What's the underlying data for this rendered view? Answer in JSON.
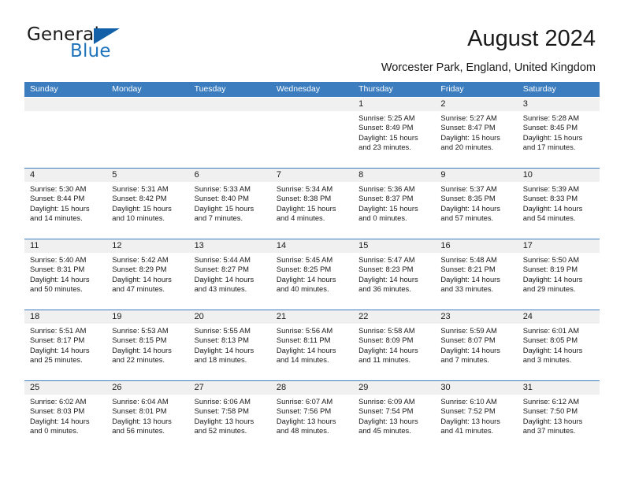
{
  "brand": {
    "name_part1": "General",
    "name_part2": "Blue",
    "accent_color": "#1261a8",
    "text_color": "#1f74bb"
  },
  "header": {
    "title": "August 2024",
    "subtitle": "Worcester Park, England, United Kingdom"
  },
  "calendar": {
    "header_bg": "#3b7dbf",
    "daynum_bg": "#f0f0f0",
    "weekday_headers": [
      "Sunday",
      "Monday",
      "Tuesday",
      "Wednesday",
      "Thursday",
      "Friday",
      "Saturday"
    ],
    "weeks": [
      [
        {
          "day": "",
          "details": ""
        },
        {
          "day": "",
          "details": ""
        },
        {
          "day": "",
          "details": ""
        },
        {
          "day": "",
          "details": ""
        },
        {
          "day": "1",
          "details": "Sunrise: 5:25 AM\nSunset: 8:49 PM\nDaylight: 15 hours\nand 23 minutes."
        },
        {
          "day": "2",
          "details": "Sunrise: 5:27 AM\nSunset: 8:47 PM\nDaylight: 15 hours\nand 20 minutes."
        },
        {
          "day": "3",
          "details": "Sunrise: 5:28 AM\nSunset: 8:45 PM\nDaylight: 15 hours\nand 17 minutes."
        }
      ],
      [
        {
          "day": "4",
          "details": "Sunrise: 5:30 AM\nSunset: 8:44 PM\nDaylight: 15 hours\nand 14 minutes."
        },
        {
          "day": "5",
          "details": "Sunrise: 5:31 AM\nSunset: 8:42 PM\nDaylight: 15 hours\nand 10 minutes."
        },
        {
          "day": "6",
          "details": "Sunrise: 5:33 AM\nSunset: 8:40 PM\nDaylight: 15 hours\nand 7 minutes."
        },
        {
          "day": "7",
          "details": "Sunrise: 5:34 AM\nSunset: 8:38 PM\nDaylight: 15 hours\nand 4 minutes."
        },
        {
          "day": "8",
          "details": "Sunrise: 5:36 AM\nSunset: 8:37 PM\nDaylight: 15 hours\nand 0 minutes."
        },
        {
          "day": "9",
          "details": "Sunrise: 5:37 AM\nSunset: 8:35 PM\nDaylight: 14 hours\nand 57 minutes."
        },
        {
          "day": "10",
          "details": "Sunrise: 5:39 AM\nSunset: 8:33 PM\nDaylight: 14 hours\nand 54 minutes."
        }
      ],
      [
        {
          "day": "11",
          "details": "Sunrise: 5:40 AM\nSunset: 8:31 PM\nDaylight: 14 hours\nand 50 minutes."
        },
        {
          "day": "12",
          "details": "Sunrise: 5:42 AM\nSunset: 8:29 PM\nDaylight: 14 hours\nand 47 minutes."
        },
        {
          "day": "13",
          "details": "Sunrise: 5:44 AM\nSunset: 8:27 PM\nDaylight: 14 hours\nand 43 minutes."
        },
        {
          "day": "14",
          "details": "Sunrise: 5:45 AM\nSunset: 8:25 PM\nDaylight: 14 hours\nand 40 minutes."
        },
        {
          "day": "15",
          "details": "Sunrise: 5:47 AM\nSunset: 8:23 PM\nDaylight: 14 hours\nand 36 minutes."
        },
        {
          "day": "16",
          "details": "Sunrise: 5:48 AM\nSunset: 8:21 PM\nDaylight: 14 hours\nand 33 minutes."
        },
        {
          "day": "17",
          "details": "Sunrise: 5:50 AM\nSunset: 8:19 PM\nDaylight: 14 hours\nand 29 minutes."
        }
      ],
      [
        {
          "day": "18",
          "details": "Sunrise: 5:51 AM\nSunset: 8:17 PM\nDaylight: 14 hours\nand 25 minutes."
        },
        {
          "day": "19",
          "details": "Sunrise: 5:53 AM\nSunset: 8:15 PM\nDaylight: 14 hours\nand 22 minutes."
        },
        {
          "day": "20",
          "details": "Sunrise: 5:55 AM\nSunset: 8:13 PM\nDaylight: 14 hours\nand 18 minutes."
        },
        {
          "day": "21",
          "details": "Sunrise: 5:56 AM\nSunset: 8:11 PM\nDaylight: 14 hours\nand 14 minutes."
        },
        {
          "day": "22",
          "details": "Sunrise: 5:58 AM\nSunset: 8:09 PM\nDaylight: 14 hours\nand 11 minutes."
        },
        {
          "day": "23",
          "details": "Sunrise: 5:59 AM\nSunset: 8:07 PM\nDaylight: 14 hours\nand 7 minutes."
        },
        {
          "day": "24",
          "details": "Sunrise: 6:01 AM\nSunset: 8:05 PM\nDaylight: 14 hours\nand 3 minutes."
        }
      ],
      [
        {
          "day": "25",
          "details": "Sunrise: 6:02 AM\nSunset: 8:03 PM\nDaylight: 14 hours\nand 0 minutes."
        },
        {
          "day": "26",
          "details": "Sunrise: 6:04 AM\nSunset: 8:01 PM\nDaylight: 13 hours\nand 56 minutes."
        },
        {
          "day": "27",
          "details": "Sunrise: 6:06 AM\nSunset: 7:58 PM\nDaylight: 13 hours\nand 52 minutes."
        },
        {
          "day": "28",
          "details": "Sunrise: 6:07 AM\nSunset: 7:56 PM\nDaylight: 13 hours\nand 48 minutes."
        },
        {
          "day": "29",
          "details": "Sunrise: 6:09 AM\nSunset: 7:54 PM\nDaylight: 13 hours\nand 45 minutes."
        },
        {
          "day": "30",
          "details": "Sunrise: 6:10 AM\nSunset: 7:52 PM\nDaylight: 13 hours\nand 41 minutes."
        },
        {
          "day": "31",
          "details": "Sunrise: 6:12 AM\nSunset: 7:50 PM\nDaylight: 13 hours\nand 37 minutes."
        }
      ]
    ]
  }
}
